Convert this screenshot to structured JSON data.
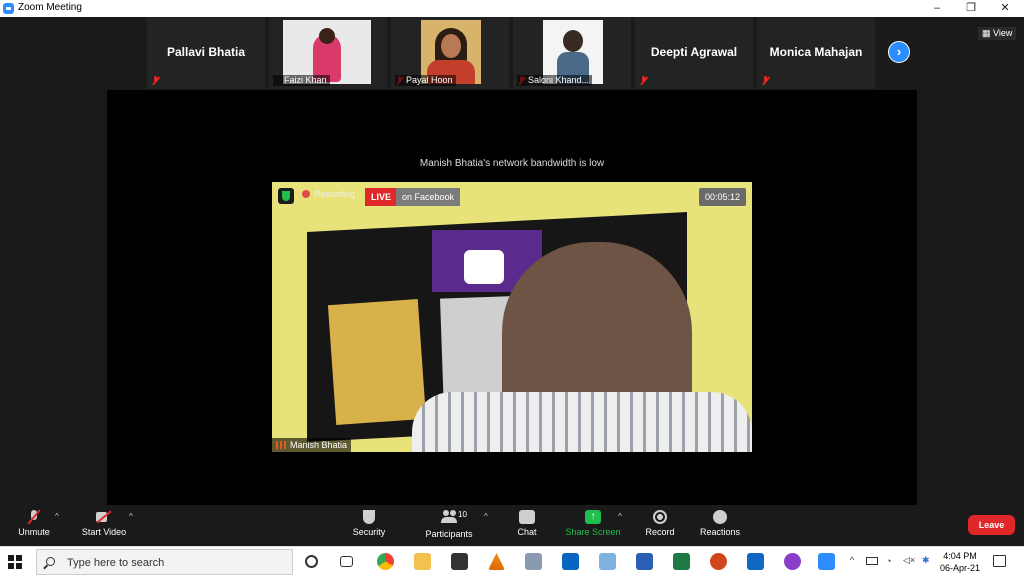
{
  "window": {
    "title": "Zoom Meeting",
    "controls": [
      "–",
      "❐",
      "✕"
    ]
  },
  "gallery": {
    "tiles": [
      {
        "name": "Pallavi Bhatia",
        "has_video": false
      },
      {
        "name": "Faizi Khan",
        "has_video": true,
        "photo_color": "#e9e9e9"
      },
      {
        "name": "Payal Hoon",
        "has_video": true,
        "photo_color": "#d7b36b"
      },
      {
        "name": "Saloni Khand...",
        "has_video": true,
        "photo_color": "#f4f4f4"
      },
      {
        "name": "Deepti Agrawal",
        "has_video": false
      },
      {
        "name": "Monica Mahajan",
        "has_video": false
      }
    ],
    "view_label": "View"
  },
  "stage": {
    "bandwidth_message": "Manish Bhatia's network bandwidth is low",
    "recording_label": "Recording",
    "live_badge": "LIVE",
    "live_on": "on Facebook",
    "timer": "00:05:12",
    "speaker_name": "Manish Bhatia"
  },
  "toolbar": {
    "unmute": "Unmute",
    "start_video": "Start Video",
    "security": "Security",
    "participants": "Participants",
    "participant_count": "10",
    "chat": "Chat",
    "share_screen": "Share Screen",
    "record": "Record",
    "reactions": "Reactions",
    "leave": "Leave",
    "accent": "#1fbe4d",
    "leave_color": "#e0282b"
  },
  "taskbar": {
    "search_placeholder": "Type here to search",
    "time": "4:04 PM",
    "date": "06-Apr-21",
    "apps": [
      "cortana-icon",
      "task-view-icon",
      "chrome-icon",
      "file-explorer-icon",
      "store-icon",
      "vlc-icon",
      "photo-viewer-icon",
      "outlook-icon",
      "paint-icon",
      "word-icon",
      "excel-icon",
      "powerpoint-icon",
      "mail-icon",
      "app-icon",
      "zoom-icon"
    ]
  }
}
